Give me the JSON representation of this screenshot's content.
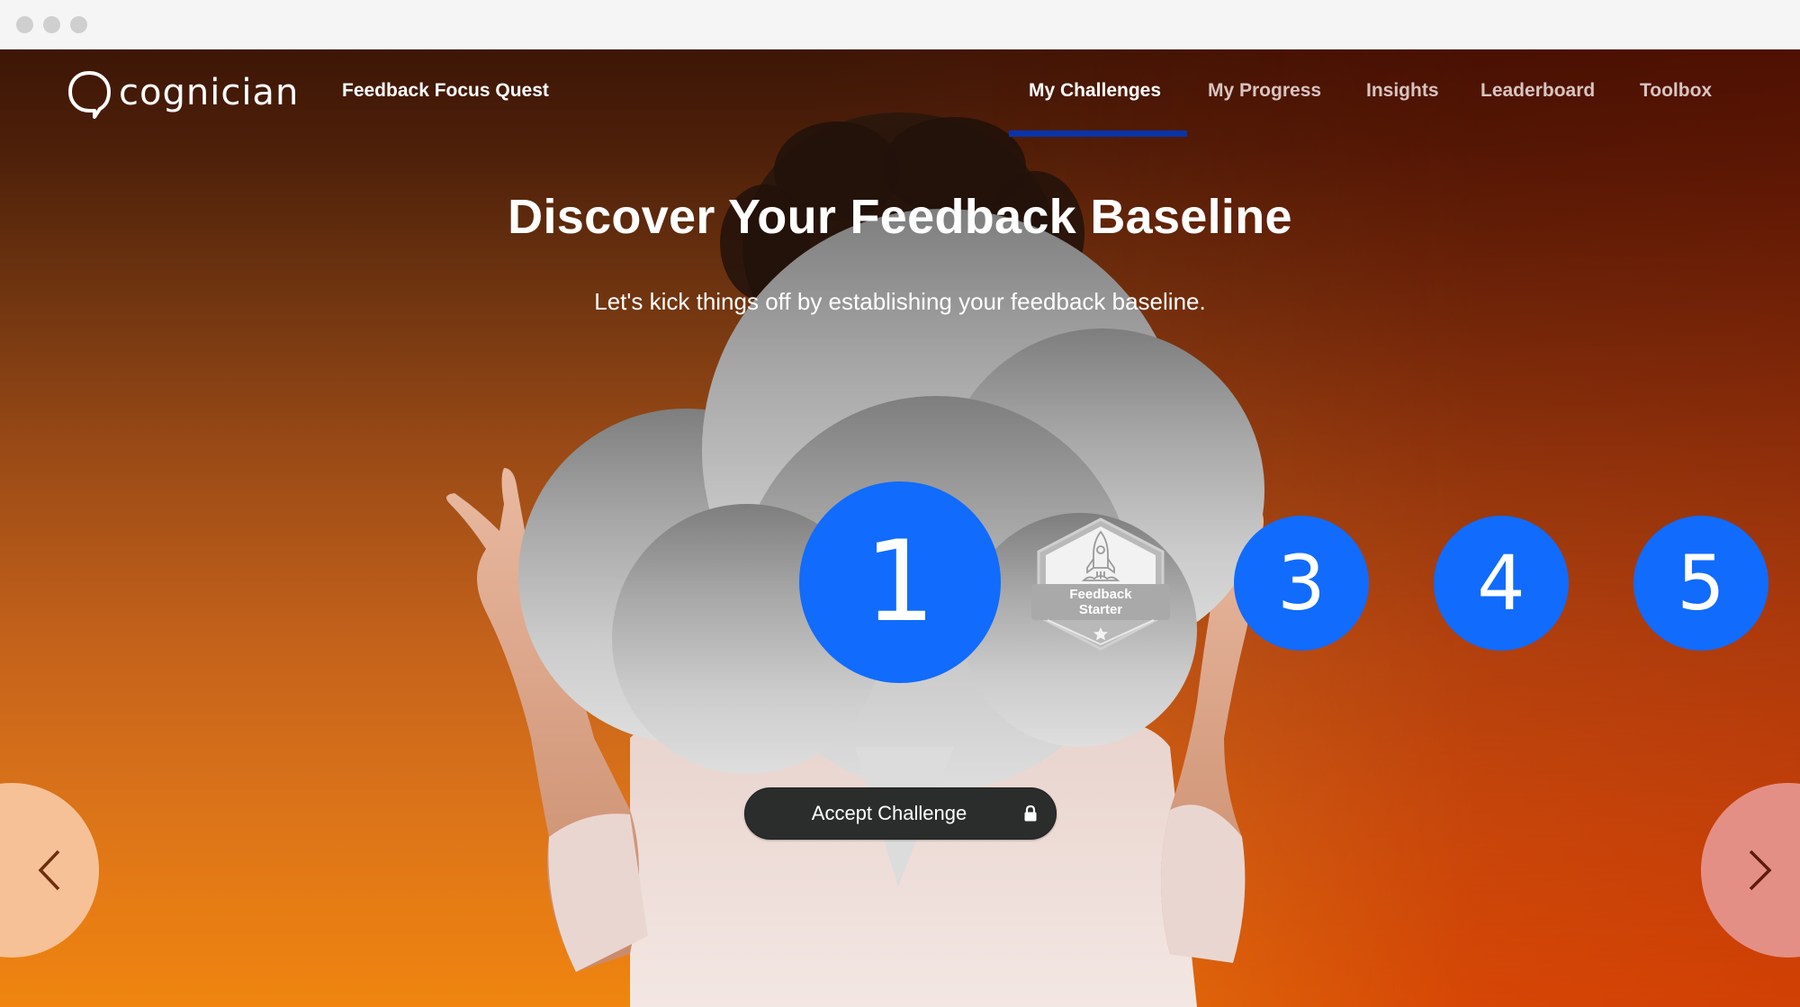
{
  "browser": {
    "window_controls": [
      "close",
      "minimize",
      "maximize"
    ]
  },
  "header": {
    "logo_text": "cognician",
    "logo_icon": "speech-bubble-icon",
    "quest_title": "Feedback Focus Quest",
    "nav": [
      {
        "label": "My Challenges",
        "active": true
      },
      {
        "label": "My Progress",
        "active": false
      },
      {
        "label": "Insights",
        "active": false
      },
      {
        "label": "Leaderboard",
        "active": false
      },
      {
        "label": "Toolbox",
        "active": false
      }
    ]
  },
  "hero": {
    "title": "Discover Your Feedback Baseline",
    "subtitle": "Let's kick things off by establishing your feedback baseline."
  },
  "steps": {
    "current": "1",
    "badge": {
      "line1": "Feedback",
      "line2": "Starter",
      "icon": "rocket-icon",
      "star_icon": "star-icon"
    },
    "upcoming": [
      "3",
      "4",
      "5"
    ]
  },
  "actions": {
    "accept_label": "Accept Challenge",
    "accept_locked": true,
    "lock_icon": "lock-icon",
    "prev_icon": "chevron-left-icon",
    "next_icon": "chevron-right-icon"
  },
  "colors": {
    "step_blue": "#116bfc",
    "nav_underline": "#0a34a8",
    "button_dark": "#2b2d2d",
    "prev_button": "#f6c196",
    "next_button": "#e48f85"
  }
}
